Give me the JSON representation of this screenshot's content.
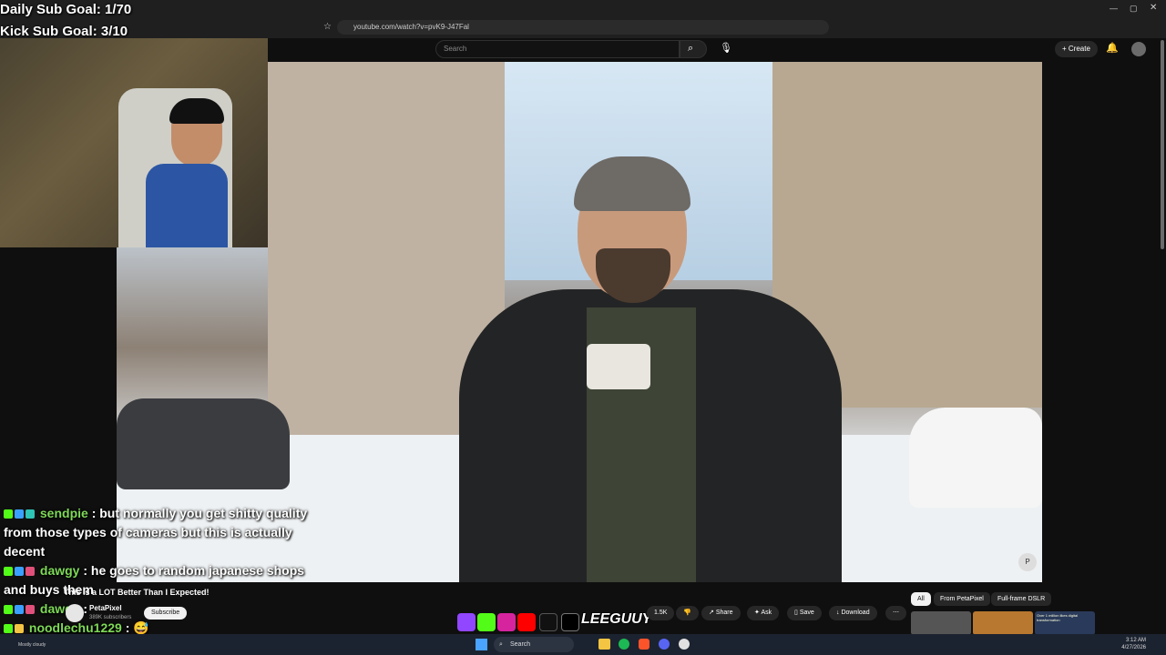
{
  "overlay": {
    "goal1": "Daily Sub Goal: 1/70",
    "goal2": "Kick Sub Goal: 3/10"
  },
  "browser": {
    "url": "youtube.com/watch?v=pvK9-J47Fal"
  },
  "youtube": {
    "search_placeholder": "Search",
    "create_label": "Create",
    "video_title": "This is a LOT Better Than I Expected!",
    "channel_name": "PetaPixel",
    "channel_subs": "389K subscribers",
    "subscribe_label": "Subscribe",
    "likes": "1.5K",
    "share_label": "Share",
    "ask_label": "Ask",
    "save_label": "Save",
    "download_label": "Download",
    "chips": [
      "All",
      "From PetaPixel",
      "Full-frame DSLR"
    ],
    "thumb_text": "Over 1 million likes digital transformation"
  },
  "chat": [
    {
      "user": "sendpie",
      "message": ": but normally you get shitty quality from those types of cameras but this is actually decent"
    },
    {
      "user": "dawgy",
      "message": ": he goes to random japanese shops and buys them"
    },
    {
      "user": "dawgy",
      "message": ":"
    },
    {
      "user": "noodlechu1229",
      "message": ":"
    }
  ],
  "streamer_logo": "LEEGUUY",
  "taskbar": {
    "search_label": "Search",
    "weather": "Mostly cloudy",
    "time": "3:12 AM",
    "date": "4/27/2026"
  },
  "colors": {
    "chat_user": "#7ed957",
    "kick_green": "#53fc18",
    "yt_bg": "#0f0f0f"
  }
}
